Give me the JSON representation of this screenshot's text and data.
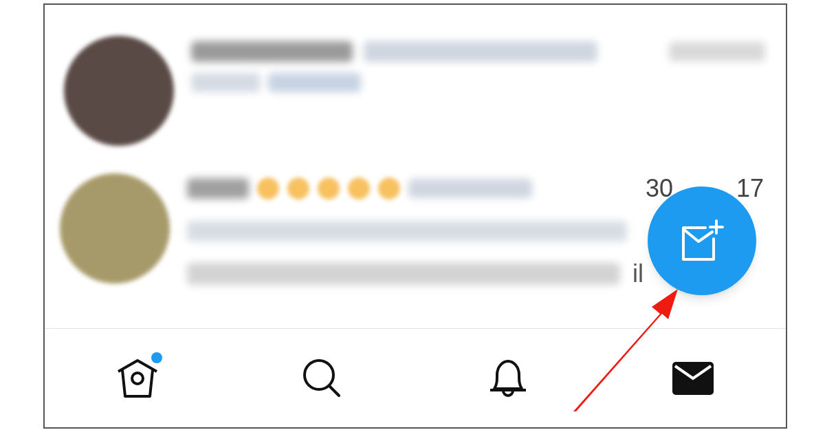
{
  "rows": [
    {
      "kind": "blurred"
    },
    {
      "kind": "partial",
      "date_start": "30",
      "date_end": "17",
      "text_fragment": "il"
    }
  ],
  "compose_button": {
    "kind": "new-message"
  },
  "tabs": [
    {
      "kind": "home",
      "badge": true,
      "selected": false
    },
    {
      "kind": "search",
      "badge": false,
      "selected": false
    },
    {
      "kind": "notifications",
      "badge": false,
      "selected": false
    },
    {
      "kind": "messages",
      "badge": false,
      "selected": true
    }
  ]
}
